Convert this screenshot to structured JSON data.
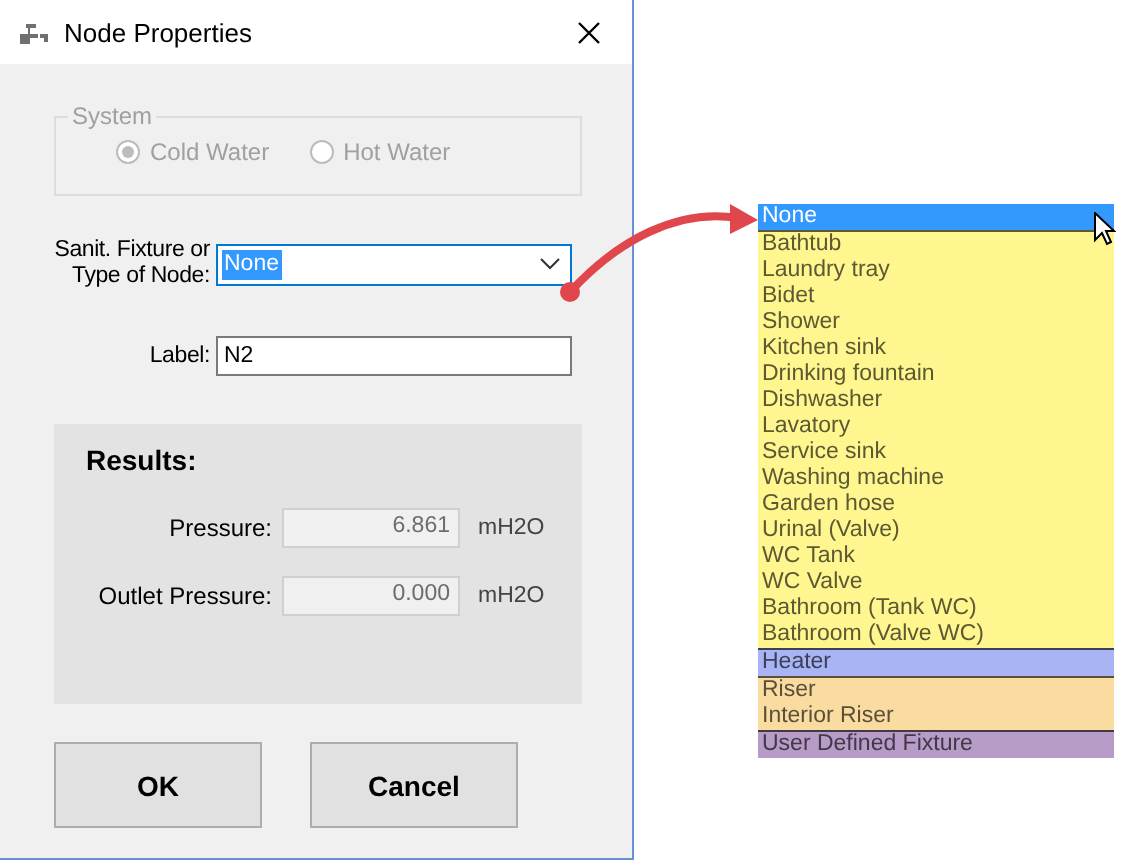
{
  "window": {
    "title": "Node Properties"
  },
  "system": {
    "title": "System",
    "disabled": true,
    "options": [
      {
        "label": "Cold Water",
        "selected": true
      },
      {
        "label": "Hot Water",
        "selected": false
      }
    ]
  },
  "fixture": {
    "label": "Sanit. Fixture or Type of Node:",
    "value": "None"
  },
  "label_field": {
    "label": "Label:",
    "value": "N2"
  },
  "results": {
    "title": "Results:",
    "fields": [
      {
        "label": "Pressure:",
        "value": "6.861",
        "unit": "mH2O",
        "disabled": true
      },
      {
        "label": "Outlet Pressure:",
        "value": "0.000",
        "unit": "mH2O",
        "disabled": true
      }
    ]
  },
  "buttons": [
    {
      "label": "OK"
    },
    {
      "label": "Cancel"
    }
  ],
  "dropdown_list": {
    "items": [
      {
        "label": "None",
        "selected": true
      },
      {
        "label": "Bathtub",
        "selected": false,
        "color": "#fff68f"
      },
      {
        "label": "Laundry tray",
        "selected": false,
        "color": "#fff68f"
      },
      {
        "label": "Bidet",
        "selected": false,
        "color": "#fff68f"
      },
      {
        "label": "Shower",
        "selected": false,
        "color": "#fff68f"
      },
      {
        "label": "Kitchen sink",
        "selected": false,
        "color": "#fff68f"
      },
      {
        "label": "Drinking fountain",
        "selected": false,
        "color": "#fff68f"
      },
      {
        "label": "Dishwasher",
        "selected": false,
        "color": "#fff68f"
      },
      {
        "label": "Lavatory",
        "selected": false,
        "color": "#fff68f"
      },
      {
        "label": "Service sink",
        "selected": false,
        "color": "#fff68f"
      },
      {
        "label": "Washing machine",
        "selected": false,
        "color": "#fff68f"
      },
      {
        "label": "Garden hose",
        "selected": false,
        "color": "#fff68f"
      },
      {
        "label": "Urinal (Valve)",
        "selected": false,
        "color": "#fff68f"
      },
      {
        "label": "WC Tank",
        "selected": false,
        "color": "#fff68f"
      },
      {
        "label": "WC Valve",
        "selected": false,
        "color": "#fff68f"
      },
      {
        "label": "Bathroom (Tank WC)",
        "selected": false,
        "color": "#fff68f"
      },
      {
        "label": "Bathroom (Valve WC)",
        "selected": false,
        "color": "#fff68f"
      },
      {
        "label": "Heater",
        "selected": false,
        "color": "#a9b4f5"
      },
      {
        "label": "Riser",
        "selected": false,
        "color": "#fbdca0"
      },
      {
        "label": "Interior Riser",
        "selected": false,
        "color": "#fbdca0"
      },
      {
        "label": "User Defined Fixture",
        "selected": false,
        "color": "#b89cc8"
      }
    ]
  }
}
